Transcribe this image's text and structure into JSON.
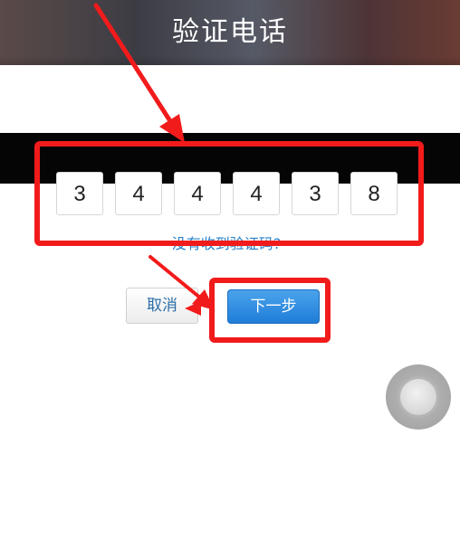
{
  "header": {
    "title": "验证电话"
  },
  "verification": {
    "digits": [
      "3",
      "4",
      "4",
      "4",
      "3",
      "8"
    ],
    "resend_link": "没有收到验证码?"
  },
  "actions": {
    "cancel_label": "取消",
    "next_label": "下一步"
  },
  "colors": {
    "highlight": "#f21b1b",
    "primary_button": "#2585dc",
    "link": "#2a7fc9",
    "header_bg": "#4a4448"
  },
  "icons": {
    "floating_button": "assistive-touch-icon"
  }
}
